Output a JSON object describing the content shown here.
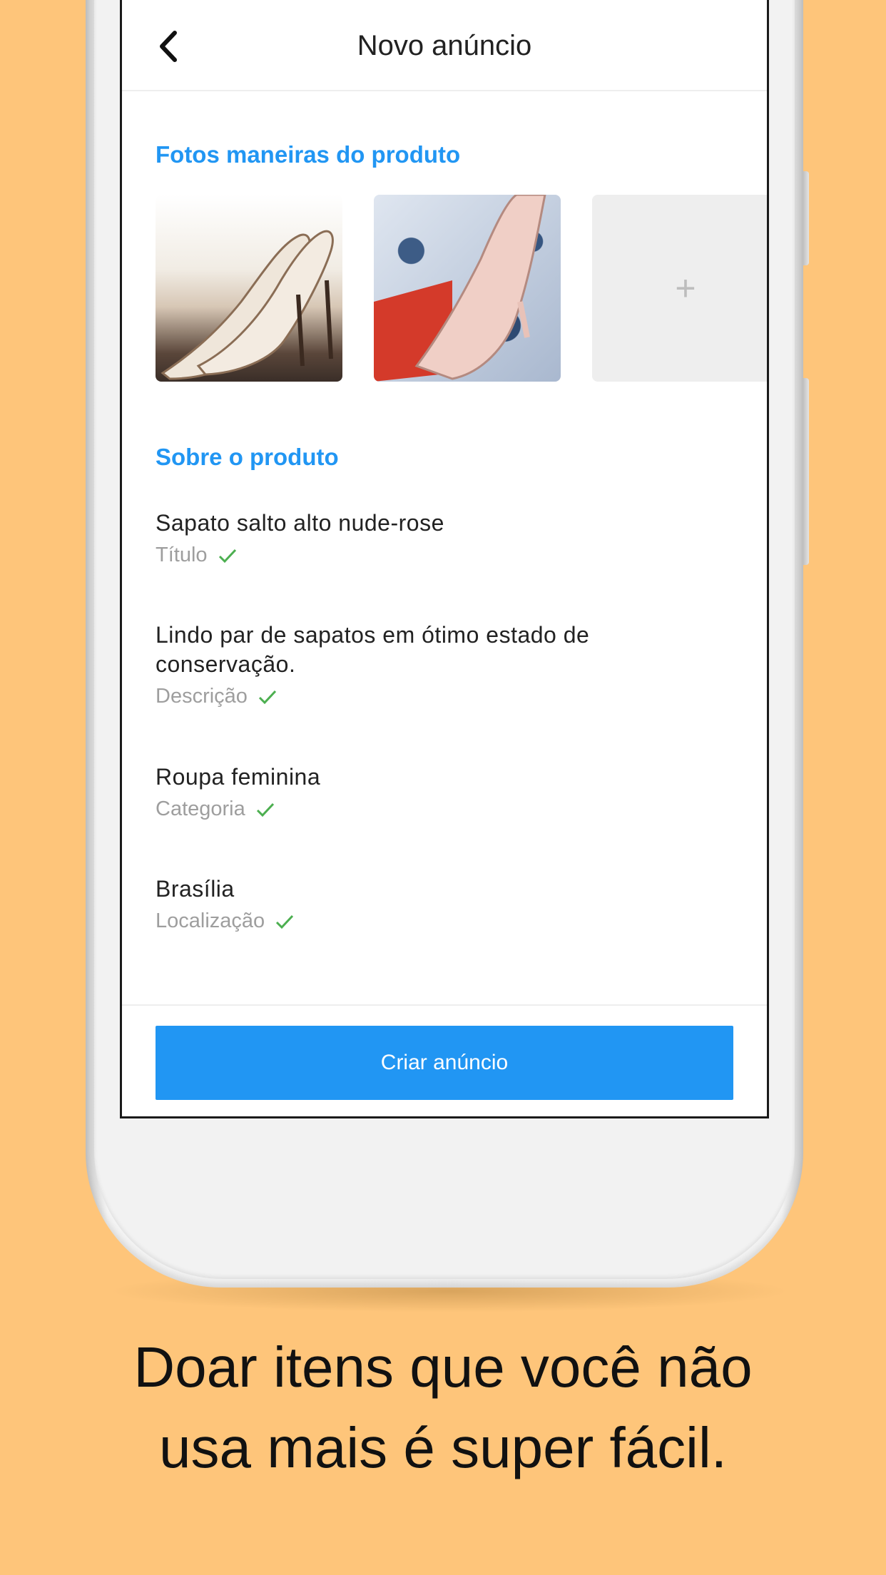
{
  "header": {
    "title": "Novo anúncio"
  },
  "photos_section": {
    "title": "Fotos maneiras do produto",
    "add_symbol": "+"
  },
  "about_section": {
    "title": "Sobre o produto",
    "fields": [
      {
        "value": "Sapato salto alto nude-rose",
        "label": "Título"
      },
      {
        "value": "Lindo par de sapatos em ótimo estado de conservação.",
        "label": "Descrição"
      },
      {
        "value": "Roupa feminina",
        "label": "Categoria"
      },
      {
        "value": "Brasília",
        "label": "Localização"
      }
    ]
  },
  "footer": {
    "submit_label": "Criar anúncio"
  },
  "caption": {
    "line1": "Doar itens que você não",
    "line2": "usa mais é super fácil."
  },
  "colors": {
    "background": "#FEC57A",
    "accent": "#2196F3",
    "check": "#4CAF50"
  },
  "icons": [
    "back-chevron-icon",
    "plus-icon",
    "check-icon"
  ]
}
